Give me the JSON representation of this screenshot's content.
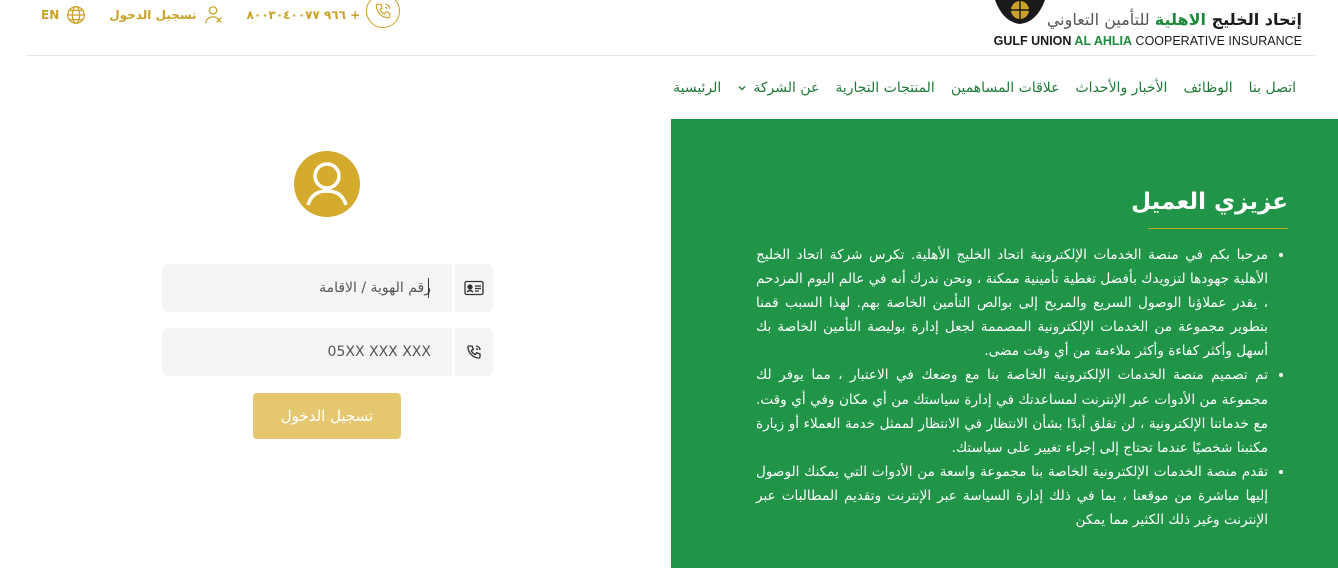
{
  "topbar": {
    "language": "EN",
    "login_link": "تسجيل الدخول",
    "phone": "+ ٩٦٦ ٨٠٠٣٠٤٠٠٧٧"
  },
  "logo": {
    "ar_prefix": "إتحاد الخليج ",
    "ar_highlight": "الاهلية",
    "ar_suffix": " للتأمين التعاوني",
    "en_bold": "GULF UNION ",
    "en_green": "AL AHLIA",
    "en_rest": " COOPERATIVE INSURANCE"
  },
  "nav": {
    "items": [
      {
        "label": "الرئيسية"
      },
      {
        "label": "عن الشركة"
      },
      {
        "label": "المنتجات التجارية"
      },
      {
        "label": "علاقات المساهمين"
      },
      {
        "label": "الأخبار والأحداث"
      },
      {
        "label": "الوظائف"
      },
      {
        "label": "اتصل بنا"
      }
    ]
  },
  "login": {
    "id_placeholder": "رقم الهوية / الاقامة",
    "phone_placeholder": "05XX XXX XXX",
    "submit_label": "تسجيل الدخول"
  },
  "panel": {
    "title": "عزيزي العميل",
    "paragraphs": [
      "مرحبا بكم في منصة الخدمات الإلكترونية اتحاد الخليج الأهلية. تكرس شركة اتحاد الخليج الأهلية جهودها لتزويدك بأفضل تغطية تأمينية ممكنة ، ونحن ندرك أنه في عالم اليوم المزدحم ، يقدر عملاؤنا الوصول السريع والمريح إلى بوالص التأمين الخاصة بهم. لهذا السبب قمنا بتطوير مجموعة من الخدمات الإلكترونية المصممة لجعل إدارة بوليصة التأمين الخاصة بك أسهل وأكثر كفاءة وأكثر ملاءمة من أي وقت مضى.",
      "تم تصميم منصة الخدمات الإلكترونية الخاصة بنا مع وضعك في الاعتبار ، مما يوفر لك مجموعة من الأدوات عبر الإنترنت لمساعدتك في إدارة سياستك من أي مكان وفي أي وقت. مع خدماتنا الإلكترونية ، لن تقلق أبدًا بشأن الانتظار في الانتظار لممثل خدمة العملاء أو زيارة مكتبنا شخصيًا عندما تحتاج إلى إجراء تغيير على سياستك.",
      "تقدم منصة الخدمات الإلكترونية الخاصة بنا مجموعة واسعة من الأدوات التي يمكنك الوصول إليها مباشرة من موقعنا ، بما في ذلك إدارة السياسة عبر الإنترنت وتقديم المطالبات عبر الإنترنت وغير ذلك الكثير مما يمكن"
    ]
  },
  "colors": {
    "gold": "#c9a227",
    "green": "#209548",
    "button": "#e5c770"
  }
}
